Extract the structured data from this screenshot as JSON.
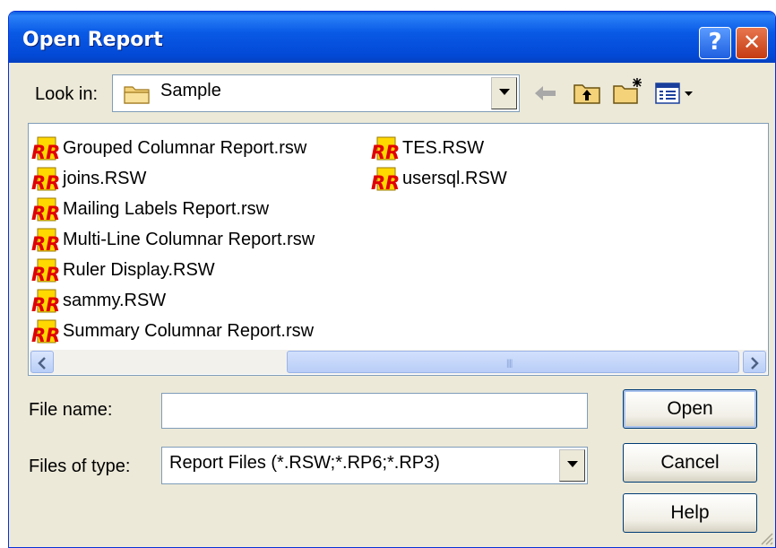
{
  "window": {
    "title": "Open Report",
    "help_button": "?",
    "close_button": "✕"
  },
  "look_in": {
    "label": "Look in:",
    "value": "Sample"
  },
  "toolbar": {
    "back": "back-arrow-icon",
    "up": "up-folder-icon",
    "new_folder": "new-folder-icon",
    "view_menu": "view-menu-icon"
  },
  "files": [
    {
      "name": "Grouped Columnar Report.rsw",
      "icon": "report-file-icon"
    },
    {
      "name": "joins.RSW",
      "icon": "report-file-icon"
    },
    {
      "name": "Mailing Labels Report.rsw",
      "icon": "report-file-icon"
    },
    {
      "name": "Multi-Line Columnar Report.rsw",
      "icon": "report-file-icon"
    },
    {
      "name": "Ruler Display.RSW",
      "icon": "report-file-icon"
    },
    {
      "name": "sammy.RSW",
      "icon": "report-file-icon"
    },
    {
      "name": "Summary Columnar Report.rsw",
      "icon": "report-file-icon"
    },
    {
      "name": "TES.RSW",
      "icon": "report-file-icon"
    },
    {
      "name": "usersql.RSW",
      "icon": "report-file-icon"
    }
  ],
  "file_name": {
    "label": "File name:",
    "value": ""
  },
  "file_type": {
    "label": "Files of type:",
    "value": "Report Files (*.RSW;*.RP6;*.RP3)"
  },
  "buttons": {
    "open": "Open",
    "cancel": "Cancel",
    "help": "Help"
  },
  "colors": {
    "titlebar": "#0a5ae6",
    "dialog_bg": "#ece9d8",
    "list_bg": "#ffffff",
    "icon_red": "#e00000",
    "icon_yellow": "#ffd800"
  }
}
